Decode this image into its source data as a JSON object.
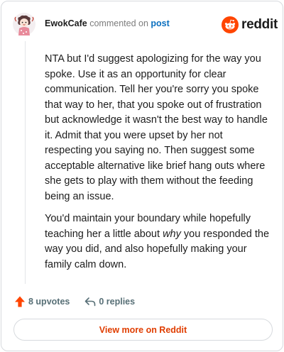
{
  "header": {
    "username": "EwokCafe",
    "action_text": "commented on",
    "link_text": "post",
    "brand_name": "reddit"
  },
  "comment": {
    "paragraph_1": "NTA but I'd suggest apologizing for the way you spoke. Use it as an opportunity for clear communication. Tell her you're sorry you spoke that way to her, that you spoke out of frustration but acknowledge it wasn't the best way to handle it. Admit that you were upset by her not respecting you saying no. Then suggest some acceptable alternative like brief hang outs where she gets to play with them without the feeding being an issue.",
    "paragraph_2_before": "You'd maintain your boundary while hopefully teaching her a little about ",
    "paragraph_2_emphasis": "why",
    "paragraph_2_after": " you responded the way you did, and also hopefully making your family calm down."
  },
  "actions": {
    "upvotes_label": "8 upvotes",
    "replies_label": "0 replies"
  },
  "footer": {
    "view_more_label": "View more on Reddit"
  },
  "icons": {
    "upvote": "arrow-up-icon",
    "reply": "reply-arrow-icon",
    "brand": "reddit-snoo-icon"
  },
  "colors": {
    "brand_orange": "#ff4500",
    "link_blue": "#0a6fbf",
    "upvote_orange": "#ff4500",
    "view_more_text": "#e03d00",
    "meta_gray": "#576f76"
  }
}
